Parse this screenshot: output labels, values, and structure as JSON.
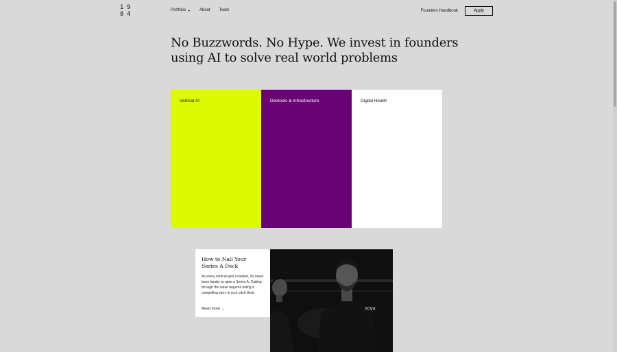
{
  "logo": {
    "line1": "19",
    "line2": "84"
  },
  "nav": {
    "portfolio": "Portfolio",
    "about": "About",
    "team": "Team"
  },
  "right_nav": {
    "handbook": "Founders Handbook",
    "apply": "Apply"
  },
  "hero": {
    "headline": "No Buzzwords. No Hype. We invest in founders using AI to solve real world problems"
  },
  "tiles": [
    {
      "label": "Vertical AI",
      "color": "#dcfa00"
    },
    {
      "label": "Devtools & Infrastructure",
      "color": "#690375"
    },
    {
      "label": "Digital Health",
      "color": "#ffffff"
    }
  ],
  "article": {
    "title": "How to Nail Your Series A Deck",
    "body": "As every vertical gets crowded, it's never been harder to raise a Series A. Cutting through the noise requires telling a compelling story in your pitch deck.",
    "read_more": "Read more →"
  },
  "photo": {
    "shirt_logo": "7CVV"
  }
}
